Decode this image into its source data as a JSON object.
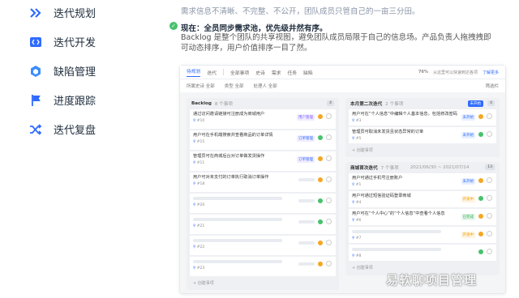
{
  "sidebar": {
    "items": [
      {
        "label": "迭代规划",
        "icon": "double-chevron-icon"
      },
      {
        "label": "迭代开发",
        "icon": "code-icon"
      },
      {
        "label": "缺陷管理",
        "icon": "bug-cube-icon"
      },
      {
        "label": "进度跟踪",
        "icon": "flag-icon"
      },
      {
        "label": "迭代复盘",
        "icon": "shuffle-icon"
      }
    ]
  },
  "content": {
    "top_text": "需求信息不清晰、不完整、不公开，团队成员只管自己的一亩三分田。",
    "heading": "现在：全员同步需求池，优先级井然有序。",
    "paragraph": "Backlog 是整个团队的共享视图，避免团队成员局限于自己的信息场。产品负责人拖拽拽即可动态排序，用户价值排序一目了然。"
  },
  "shot": {
    "tabs": [
      "待规划",
      "迭代",
      "全部事项",
      "史诗",
      "需求",
      "任务",
      "缺陷"
    ],
    "active_tab": "待规划",
    "top_right": [
      "76%",
      "从这里可以快速到达各项",
      "了解更多"
    ],
    "filters": [
      "所属史诗 全部",
      "类型 全部",
      "处理人 全部"
    ],
    "filter_right": "筛选栏",
    "backlog": {
      "title": "Backlog",
      "count": "8 个事项",
      "badge": "4",
      "cards": [
        {
          "title": "通过访问邀请链接可注册成为商城用户",
          "id": "#10",
          "tag": "用户管理",
          "tagcolor": "#7d5cff"
        },
        {
          "title": "用户可在手机端搜索并查看商品的订单详情",
          "id": "#15",
          "tag": "订单管理",
          "tagcolor": "#2f6bff"
        },
        {
          "title": "管理员可在商城后台对订单做发货操作",
          "id": "#11",
          "tag": "订单管理",
          "tagcolor": "#2f6bff"
        },
        {
          "title": "用户可对未支付的订单执行取消订单操作",
          "id": "#18",
          "tag": "",
          "tagcolor": ""
        },
        {
          "title": "",
          "id": "#20",
          "tag": "",
          "tagcolor": ""
        },
        {
          "title": "",
          "id": "#21",
          "tag": "",
          "tagcolor": ""
        },
        {
          "title": "",
          "id": "#22",
          "tag": "",
          "tagcolor": ""
        },
        {
          "title": "",
          "id": "#23",
          "tag": "",
          "tagcolor": ""
        }
      ],
      "add": "+ 创建事项"
    },
    "sprint2": {
      "title": "本月第二次迭代",
      "count": "2 个事项",
      "badge": "未开始",
      "badge_num": "4",
      "cards": [
        {
          "title": "用户可在“个人信息”中编辑个人基本信息，包括修改密码",
          "id": "#3",
          "tag": "未开始"
        },
        {
          "title": "管理员可取消未发货且状态异常的订单",
          "id": "#5",
          "tag": "未开始"
        }
      ],
      "add": "+ 创建事项"
    },
    "sprint1": {
      "title": "商城首次迭代",
      "count": "7 个事项",
      "dates": "2021/06/30 ~ 2021/07/14",
      "badge": "13",
      "cards": [
        {
          "title": "用户可通过手机号注册账户",
          "id": "#1",
          "tag": "未开始"
        },
        {
          "title": "用户可通过短信验证码登录商城",
          "id": "#4",
          "tag": "开发中"
        },
        {
          "title": "用户可在“个人中心”的“个人信息”中查看个人信息",
          "id": "#6",
          "tag": "已完成"
        },
        {
          "title": "",
          "id": "#7",
          "tag": "开发中"
        },
        {
          "title": "",
          "id": "#8",
          "tag": ""
        }
      ],
      "add": "+ 创建事项"
    }
  },
  "watermark": "易软聊项目管理"
}
